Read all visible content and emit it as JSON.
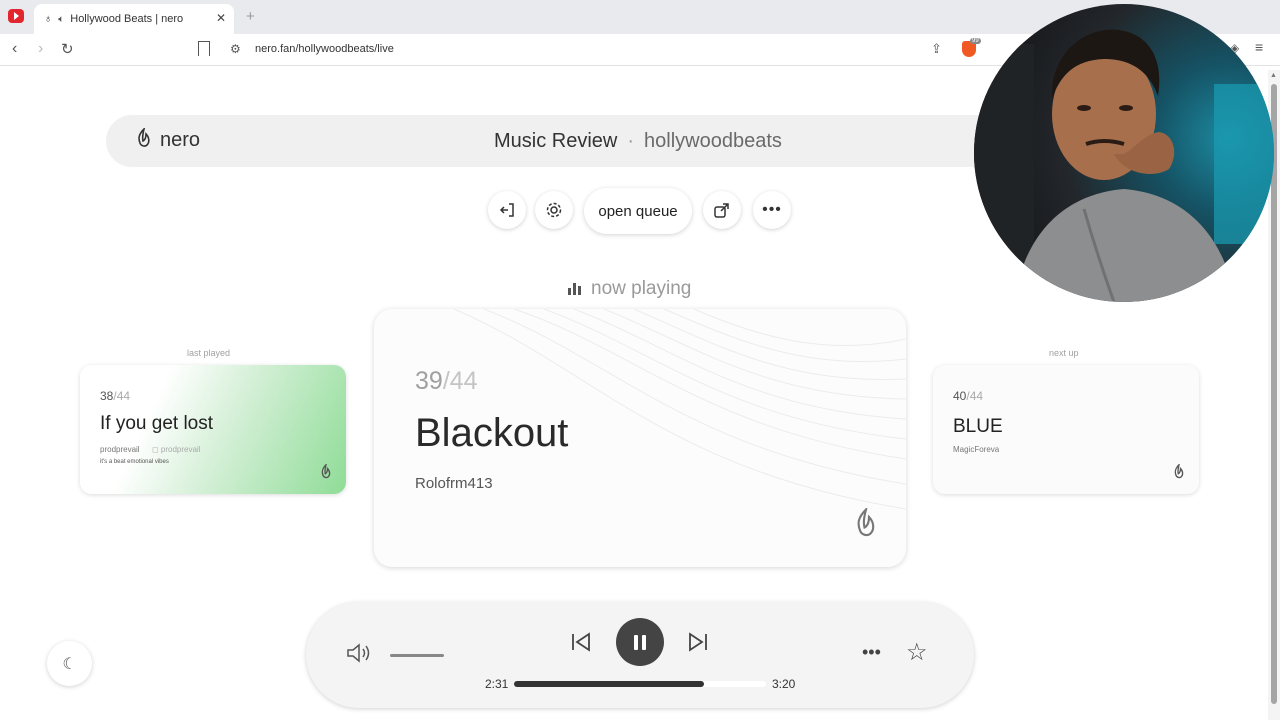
{
  "browser": {
    "tab_title": "Hollywood Beats | nero",
    "url": "nero.fan/hollywoodbeats/live"
  },
  "header": {
    "brand": "nero",
    "title": "Music Review",
    "separator": "·",
    "channel": "hollywoodbeats"
  },
  "controls": {
    "queue_label": "open queue"
  },
  "now_playing_label": "now playing",
  "last_played": {
    "label": "last played",
    "index": "38",
    "total": "/44",
    "title": "If you get lost",
    "artist": "prodprevail",
    "handle": "prodprevail",
    "description": "it's a beat emotional vibes"
  },
  "current": {
    "index": "39",
    "total": "/44",
    "title": "Blackout",
    "artist": "Rolofrm413"
  },
  "next_up": {
    "label": "next up",
    "index": "40",
    "total": "/44",
    "title": "BLUE",
    "artist": "MagicForeva"
  },
  "player": {
    "current_time": "2:31",
    "total_time": "3:20",
    "progress": 0.755,
    "volume": 0.0
  },
  "colors": {
    "accent_dark": "#444444",
    "card_gradient": "#8fdc97",
    "youtube_red": "#e3262e"
  },
  "icons": {
    "brand": "flame-icon",
    "exit": "exit-icon",
    "settings": "gear-icon",
    "share": "share-icon",
    "more": "more-icon",
    "theme": "moon-icon",
    "volume": "volume-icon",
    "previous": "skip-previous-icon",
    "pause": "pause-icon",
    "next": "skip-next-icon",
    "favorite": "star-icon"
  }
}
